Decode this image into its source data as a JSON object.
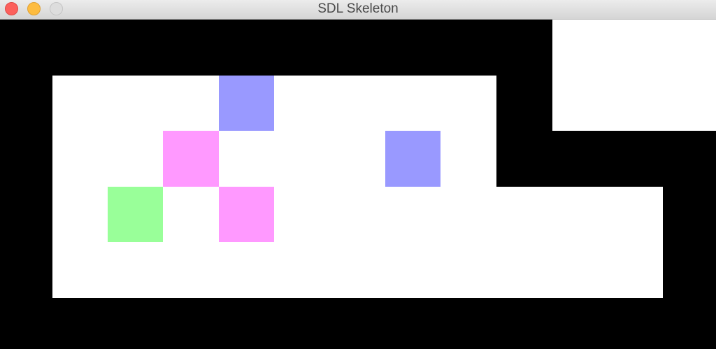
{
  "window": {
    "title": "SDL Skeleton"
  },
  "game": {
    "background_color": "#000000",
    "floor_color": "#ffffff",
    "tile_colors": {
      "blue": "#9999ff",
      "pink": "#ff99ff",
      "green": "#99ff99"
    }
  }
}
